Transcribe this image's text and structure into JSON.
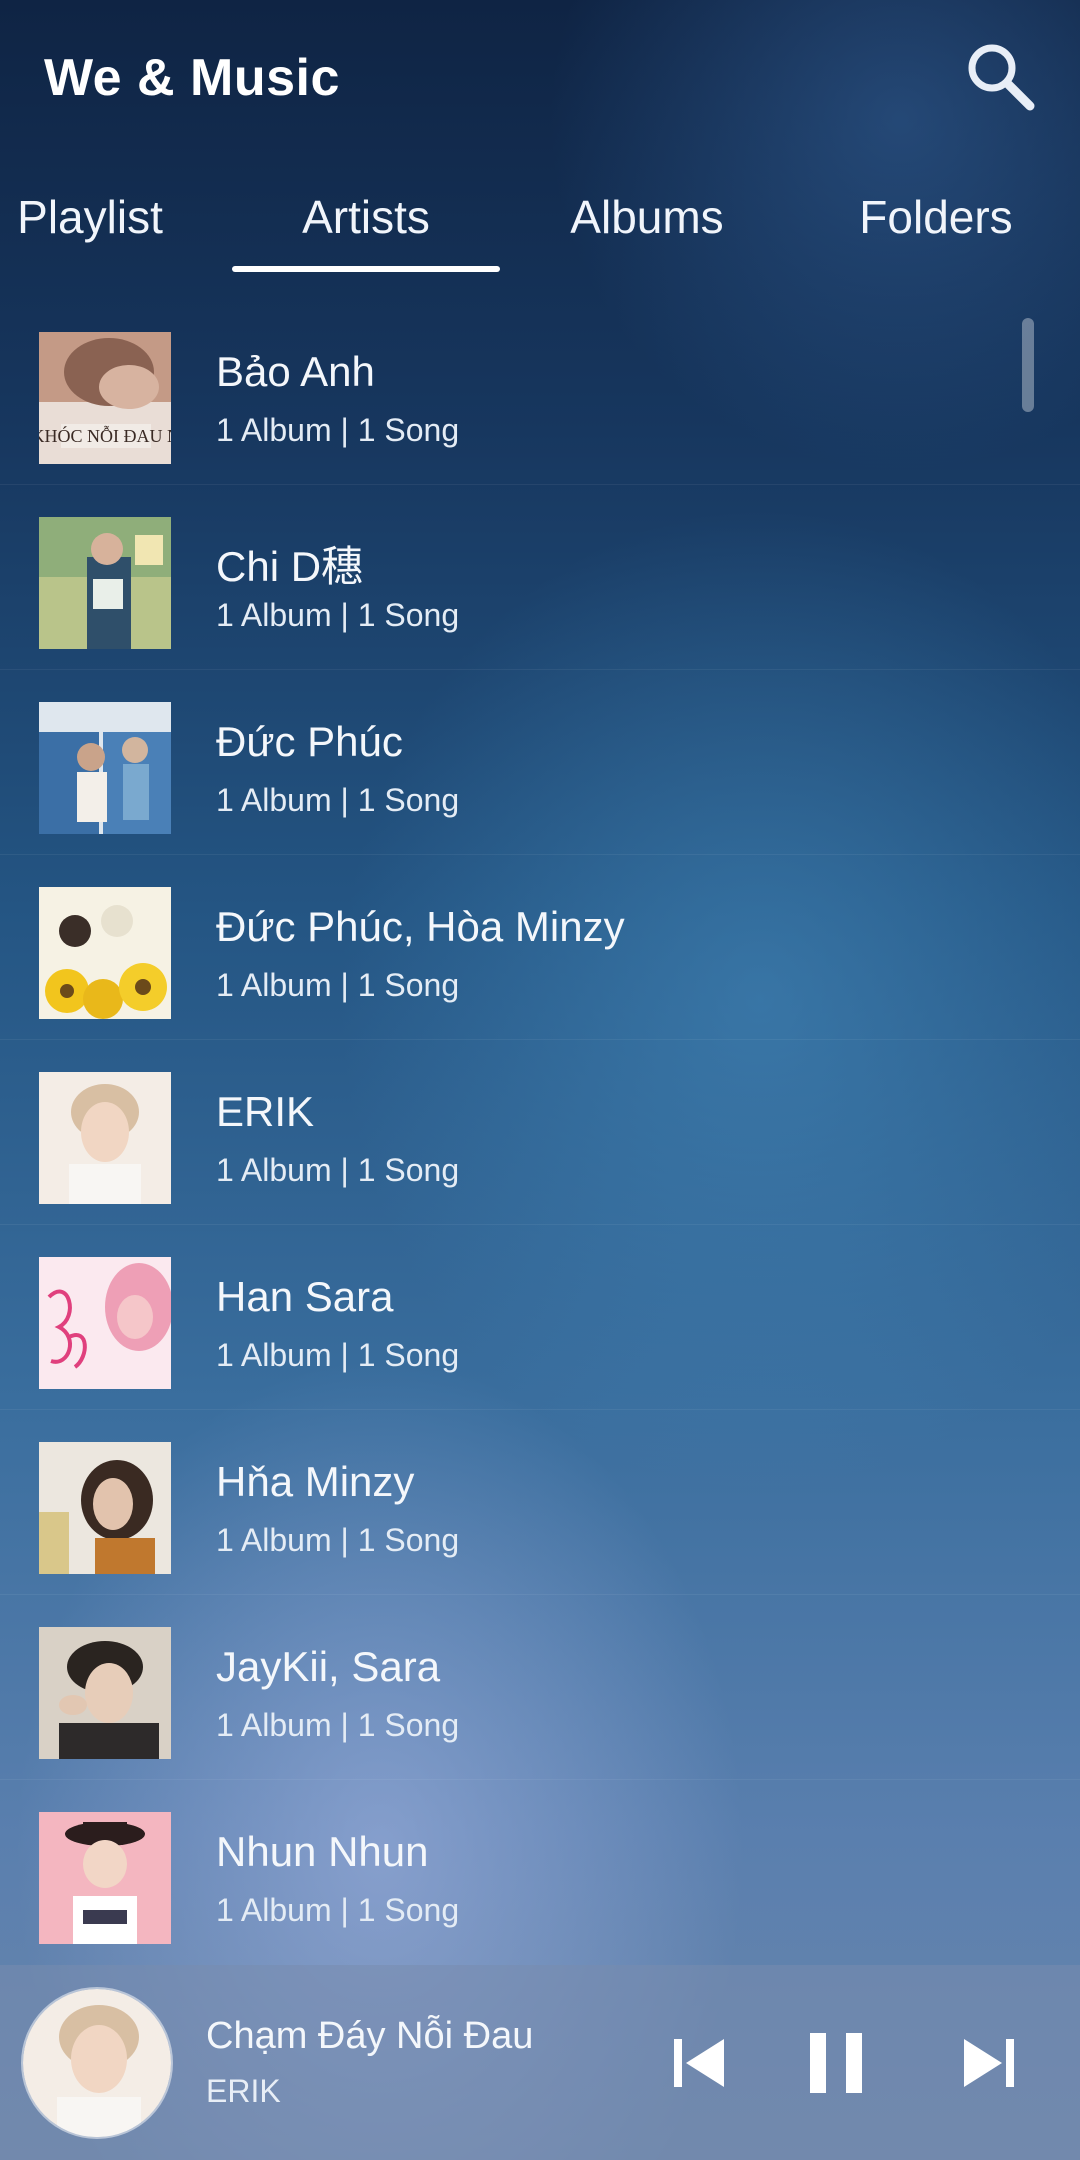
{
  "app": {
    "title": "We & Music"
  },
  "tabs": [
    {
      "label": "Playlist",
      "selected": false
    },
    {
      "label": "Artists",
      "selected": true
    },
    {
      "label": "Albums",
      "selected": false
    },
    {
      "label": "Folders",
      "selected": false
    }
  ],
  "artists": [
    {
      "name": "Bảo Anh",
      "meta": "1 Album | 1 Song",
      "art_text": "AI KHÓC NỖI ĐAU NÀY"
    },
    {
      "name": "Chi D穗",
      "meta": "1 Album | 1 Song",
      "art_text": ""
    },
    {
      "name": "Đức Phúc",
      "meta": "1 Album | 1 Song",
      "art_text": ""
    },
    {
      "name": "Đức Phúc, Hòa Minzy",
      "meta": "1 Album | 1 Song",
      "art_text": ""
    },
    {
      "name": "ERIK",
      "meta": "1 Album | 1 Song",
      "art_text": ""
    },
    {
      "name": "Han Sara",
      "meta": "1 Album | 1 Song",
      "art_text": ""
    },
    {
      "name": "Hňa Minzy",
      "meta": "1 Album | 1 Song",
      "art_text": ""
    },
    {
      "name": "JayKii, Sara",
      "meta": "1 Album | 1 Song",
      "art_text": ""
    },
    {
      "name": "Nhun Nhun",
      "meta": "1 Album | 1 Song",
      "art_text": ""
    }
  ],
  "player": {
    "song_title": "Chạm Đáy Nỗi Đau",
    "song_artist": "ERIK",
    "state": "playing"
  },
  "colors": {
    "accent": "#ffffff",
    "background_top": "#0f2444",
    "background_bottom": "#6a86ac"
  },
  "icons": {
    "search": "search-icon",
    "previous": "skip-previous-icon",
    "pause": "pause-icon",
    "next": "skip-next-icon"
  }
}
